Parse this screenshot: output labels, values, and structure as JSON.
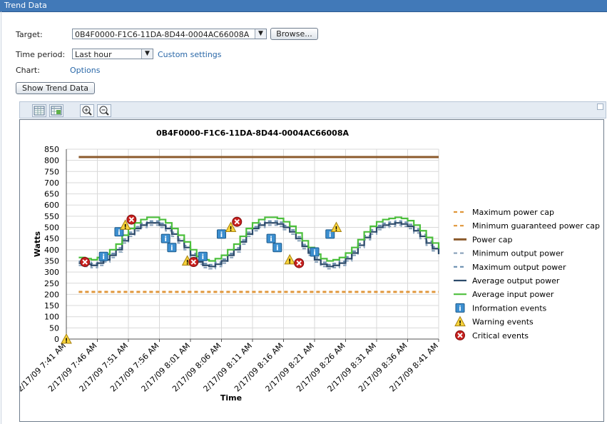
{
  "window": {
    "title": "Trend Data"
  },
  "form": {
    "target_label": "Target:",
    "target_value": "0B4F0000-F1C6-11DA-8D44-0004AC66008A",
    "browse_label": "Browse...",
    "time_period_label": "Time period:",
    "time_period_value": "Last hour",
    "custom_settings_label": "Custom settings",
    "chart_label": "Chart:",
    "options_label": "Options",
    "show_button_label": "Show Trend Data"
  },
  "toolbar": {
    "icons": [
      "table-view-icon",
      "table-export-icon",
      "zoom-in-icon",
      "zoom-out-icon"
    ]
  },
  "chart_data": {
    "type": "line",
    "title": "0B4F0000-F1C6-11DA-8D44-0004AC66008A",
    "xlabel": "Time",
    "ylabel": "Watts",
    "ylim": [
      0,
      850
    ],
    "yticks": [
      0,
      50,
      100,
      150,
      200,
      250,
      300,
      350,
      400,
      450,
      500,
      550,
      600,
      650,
      700,
      750,
      800,
      850
    ],
    "xticks": [
      "2/17/09 7:41 AM",
      "2/17/09 7:46 AM",
      "2/17/09 7:51 AM",
      "2/17/09 7:56 AM",
      "2/17/09 8:01 AM",
      "2/17/09 8:06 AM",
      "2/17/09 8:11 AM",
      "2/17/09 8:16 AM",
      "2/17/09 8:21 AM",
      "2/17/09 8:26 AM",
      "2/17/09 8:31 AM",
      "2/17/09 8:36 AM",
      "2/17/09 8:41 AM"
    ],
    "x_minutes": [
      2,
      3,
      4,
      5,
      6,
      7,
      8,
      9,
      10,
      11,
      12,
      13,
      14,
      15,
      16,
      17,
      18,
      19,
      20,
      21,
      22,
      23,
      24,
      25,
      26,
      27,
      28,
      29,
      30,
      31,
      32,
      33,
      34,
      35,
      36,
      37,
      38,
      39,
      40,
      41,
      42,
      43,
      44,
      45,
      46,
      47,
      48,
      49,
      50,
      51,
      52,
      53,
      54,
      55,
      56,
      57,
      58,
      59,
      60
    ],
    "grid": true,
    "legend_position": "right",
    "series": [
      {
        "name": "Maximum power cap",
        "color": "#e0963a",
        "dash": "dash",
        "constant": 210
      },
      {
        "name": "Minimum guaranteed power cap",
        "color": "#e0963a",
        "dash": "dash",
        "constant": 212
      },
      {
        "name": "Power cap",
        "color": "#8b5a2b",
        "dash": "solid",
        "constant": 815
      },
      {
        "name": "Minimum output power",
        "color": "#8ea6bd",
        "dash": "dash",
        "offset": -10
      },
      {
        "name": "Maximum output power",
        "color": "#6a8fb0",
        "dash": "dash",
        "offset": 8
      },
      {
        "name": "Average output power",
        "color": "#2c4a6a",
        "dash": "solid",
        "offset": 0
      },
      {
        "name": "Average input power",
        "color": "#4cbf3c",
        "dash": "solid",
        "offset": 25
      }
    ],
    "base_values": [
      340,
      335,
      330,
      340,
      355,
      375,
      400,
      440,
      470,
      495,
      510,
      520,
      520,
      510,
      495,
      470,
      440,
      410,
      375,
      345,
      330,
      325,
      335,
      350,
      375,
      400,
      435,
      470,
      495,
      510,
      520,
      520,
      515,
      500,
      480,
      450,
      415,
      385,
      355,
      335,
      325,
      330,
      340,
      360,
      385,
      420,
      455,
      480,
      500,
      510,
      515,
      520,
      515,
      505,
      485,
      460,
      430,
      405,
      380
    ],
    "events": [
      {
        "type": "warning",
        "minute": 0,
        "value": 0
      },
      {
        "type": "critical",
        "minute": 3,
        "value": 345
      },
      {
        "type": "information",
        "minute": 6,
        "value": 370
      },
      {
        "type": "information",
        "minute": 8.5,
        "value": 480
      },
      {
        "type": "warning",
        "minute": 9.5,
        "value": 510
      },
      {
        "type": "critical",
        "minute": 10.5,
        "value": 535
      },
      {
        "type": "information",
        "minute": 16,
        "value": 450
      },
      {
        "type": "information",
        "minute": 17,
        "value": 410
      },
      {
        "type": "warning",
        "minute": 19.5,
        "value": 350
      },
      {
        "type": "critical",
        "minute": 20.5,
        "value": 345
      },
      {
        "type": "information",
        "minute": 22,
        "value": 370
      },
      {
        "type": "information",
        "minute": 25,
        "value": 470
      },
      {
        "type": "warning",
        "minute": 26.5,
        "value": 500
      },
      {
        "type": "critical",
        "minute": 27.5,
        "value": 525
      },
      {
        "type": "information",
        "minute": 33,
        "value": 450
      },
      {
        "type": "information",
        "minute": 34,
        "value": 410
      },
      {
        "type": "warning",
        "minute": 36,
        "value": 355
      },
      {
        "type": "critical",
        "minute": 37.5,
        "value": 340
      },
      {
        "type": "information",
        "minute": 40,
        "value": 390
      },
      {
        "type": "information",
        "minute": 42.5,
        "value": 470
      },
      {
        "type": "warning",
        "minute": 43.5,
        "value": 500
      }
    ],
    "legend_events": [
      {
        "name": "Information events",
        "type": "information"
      },
      {
        "name": "Warning events",
        "type": "warning"
      },
      {
        "name": "Critical events",
        "type": "critical"
      }
    ]
  }
}
